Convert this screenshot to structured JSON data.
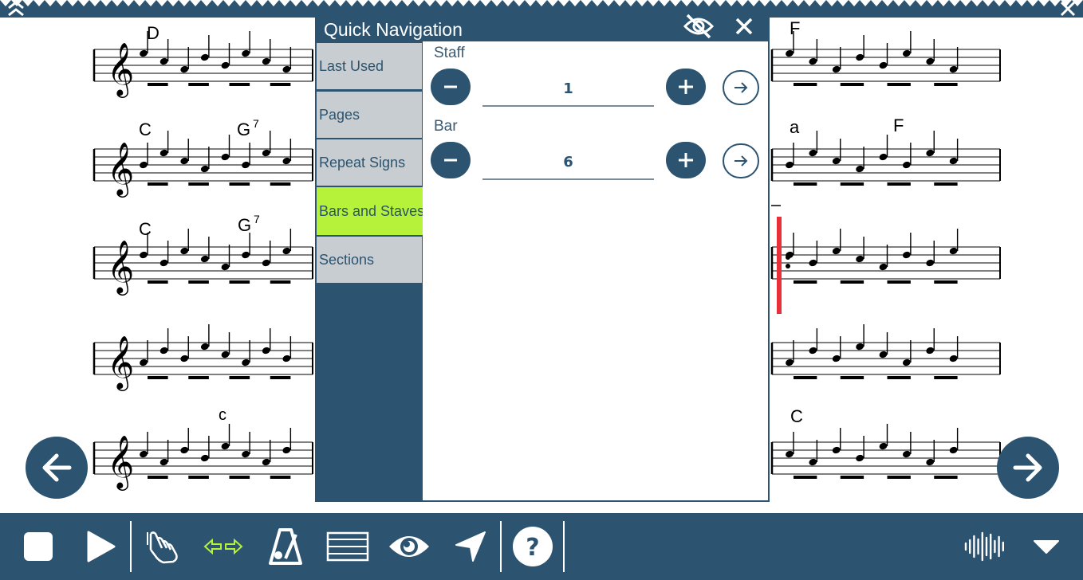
{
  "dialog": {
    "title": "Quick Navigation",
    "sidebar": [
      {
        "label": "Last Used",
        "active": false
      },
      {
        "label": "Pages",
        "active": false
      },
      {
        "label": "Repeat Signs",
        "active": false
      },
      {
        "label": "Bars and Staves",
        "active": true
      },
      {
        "label": "Sections",
        "active": false
      }
    ],
    "staff": {
      "label": "Staff",
      "value": "1"
    },
    "bar": {
      "label": "Bar",
      "value": "6"
    }
  },
  "score": {
    "chords_left": [
      "D",
      "C",
      "G",
      "7",
      "C",
      "G",
      "7",
      "c"
    ],
    "chords_right": [
      "F",
      "a",
      "F",
      "C"
    ]
  },
  "colors": {
    "primary": "#2c5470",
    "active_tab": "#b6f23a",
    "tab_bg": "#c8cdd1",
    "cursor": "#e8303a",
    "arrows": "#b6f23a"
  },
  "icons": {
    "toolbar": [
      "stop-icon",
      "play-icon",
      "hand-pointer-icon",
      "swap-arrows-icon",
      "metronome-icon",
      "staff-lines-icon",
      "eye-icon",
      "navigate-icon",
      "help-icon",
      "audio-wave-icon",
      "dropdown-icon"
    ],
    "nav": [
      "arrow-left-icon",
      "arrow-right-icon"
    ],
    "dialog": [
      "eye-off-icon",
      "close-icon",
      "minus-icon",
      "plus-icon",
      "go-arrow-icon"
    ]
  }
}
